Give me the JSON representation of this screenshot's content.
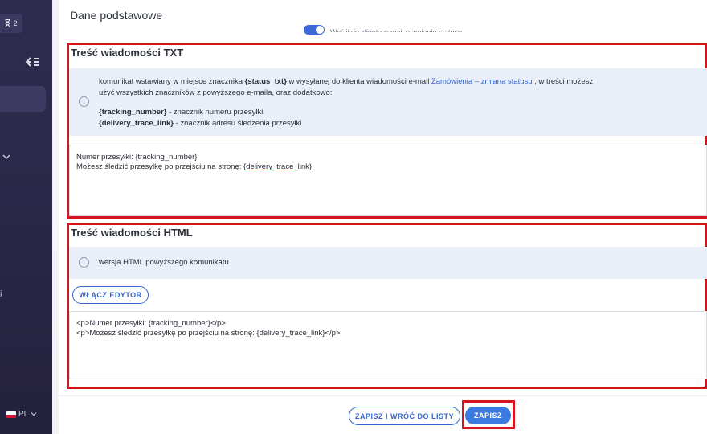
{
  "sidebar": {
    "badge_count": "2",
    "side_letter": "i",
    "language": "PL"
  },
  "main": {
    "section_title": "Dane podstawowe",
    "toggle_label": "Wyślij do klienta e-mail o zmianie statusu"
  },
  "txt_block": {
    "title": "Treść wiadomości TXT",
    "info": {
      "line1_pre": "komunikat wstawiany w miejsce znacznika ",
      "line1_tag": "{status_txt}",
      "line1_mid": " w wysyłanej do klienta wiadomości e-mail ",
      "line1_link": "Zamówienia – zmiana statusu",
      "line1_post": " , w treści możesz",
      "line2": "użyć wszystkich znaczników z powyższego e-maila, oraz dodatkowo:",
      "tag1": "{tracking_number}",
      "tag1_desc": " - znacznik numeru przesyłki",
      "tag2": "{delivery_trace_link}",
      "tag2_desc": " - znacznik adresu śledzenia przesyłki"
    },
    "content_line1": "Numer przesyłki: {tracking_number}",
    "content_line2_pre": "Możesz śledzić przesyłkę po przejściu na stronę: {",
    "content_line2_underlined": "delivery_trace",
    "content_line2_post": "_link}"
  },
  "html_block": {
    "title": "Treść wiadomości HTML",
    "info_text": "wersja HTML powyższego komunikatu",
    "enable_editor_label": "WŁĄCZ EDYTOR",
    "content_line1": "<p>Numer przesyłki: {tracking_number}</p>",
    "content_line2": "<p>Możesz śledzić przesyłkę po przejściu na stronę: {delivery_trace_link}</p>"
  },
  "footer": {
    "save_and_back_label": "ZAPISZ I WRÓĆ DO LISTY",
    "save_label": "ZAPISZ"
  },
  "colors": {
    "accent": "#3466c9",
    "highlight": "#d7141e",
    "sidebar": "#2e2b4f",
    "info_bg": "#e9eef9"
  }
}
